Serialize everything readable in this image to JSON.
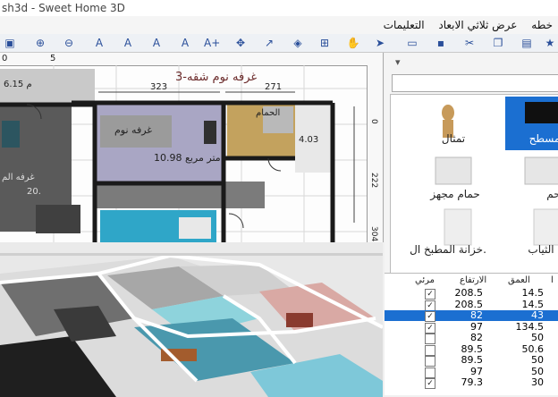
{
  "window": {
    "title": "sh3d - Sweet Home 3D"
  },
  "menu": [
    "خطه",
    "عرض ثلاثي الابعاد",
    "التعليمات"
  ],
  "plan": {
    "room_title": "3-غرفه نوم شقه",
    "dim_top_1": "323",
    "dim_top_2": "271",
    "room_bedroom_label": "غرفه نوم",
    "room_bedroom_area": "10.98 متر مربع",
    "room_bath_label": "الحمام",
    "room_small_area": "4.03",
    "left_area": "6.15 م",
    "left_label": "غرفه الم",
    "left_dim": "20.",
    "ruler_v_1": "222",
    "ruler_v_2": "304",
    "ruler_v_top": "0",
    "ruler_h_marks": [
      "0",
      "5"
    ]
  },
  "catalog": {
    "items": [
      {
        "name": "تمثال"
      },
      {
        "name": "مسطح"
      },
      {
        "name": "حمام مجهز"
      },
      {
        "name": "حم"
      },
      {
        "name": "خزانة المطبخ ال."
      },
      {
        "name": "الثياب"
      }
    ]
  },
  "furniture_table": {
    "headers": [
      "مرئي",
      "الارتفاع",
      "العمق",
      "ا"
    ],
    "rows": [
      {
        "visible": true,
        "height": "208.5",
        "depth": "14.5",
        "selected": false
      },
      {
        "visible": true,
        "height": "208.5",
        "depth": "14.5",
        "selected": false
      },
      {
        "visible": true,
        "height": "82",
        "depth": "43",
        "selected": true
      },
      {
        "visible": true,
        "height": "97",
        "depth": "134.5",
        "selected": false
      },
      {
        "visible": false,
        "height": "82",
        "depth": "50",
        "selected": false
      },
      {
        "visible": false,
        "height": "89.5",
        "depth": "50.6",
        "selected": false
      },
      {
        "visible": false,
        "height": "89.5",
        "depth": "50",
        "selected": false
      },
      {
        "visible": false,
        "height": "97",
        "depth": "50",
        "selected": false
      },
      {
        "visible": true,
        "height": "79.3",
        "depth": "30",
        "selected": false
      }
    ]
  },
  "colors": {
    "selection": "#1b6fd1",
    "toolbar": "#eef1f5",
    "wall": "#1a1a1a",
    "accent": "#2a4f9a"
  }
}
